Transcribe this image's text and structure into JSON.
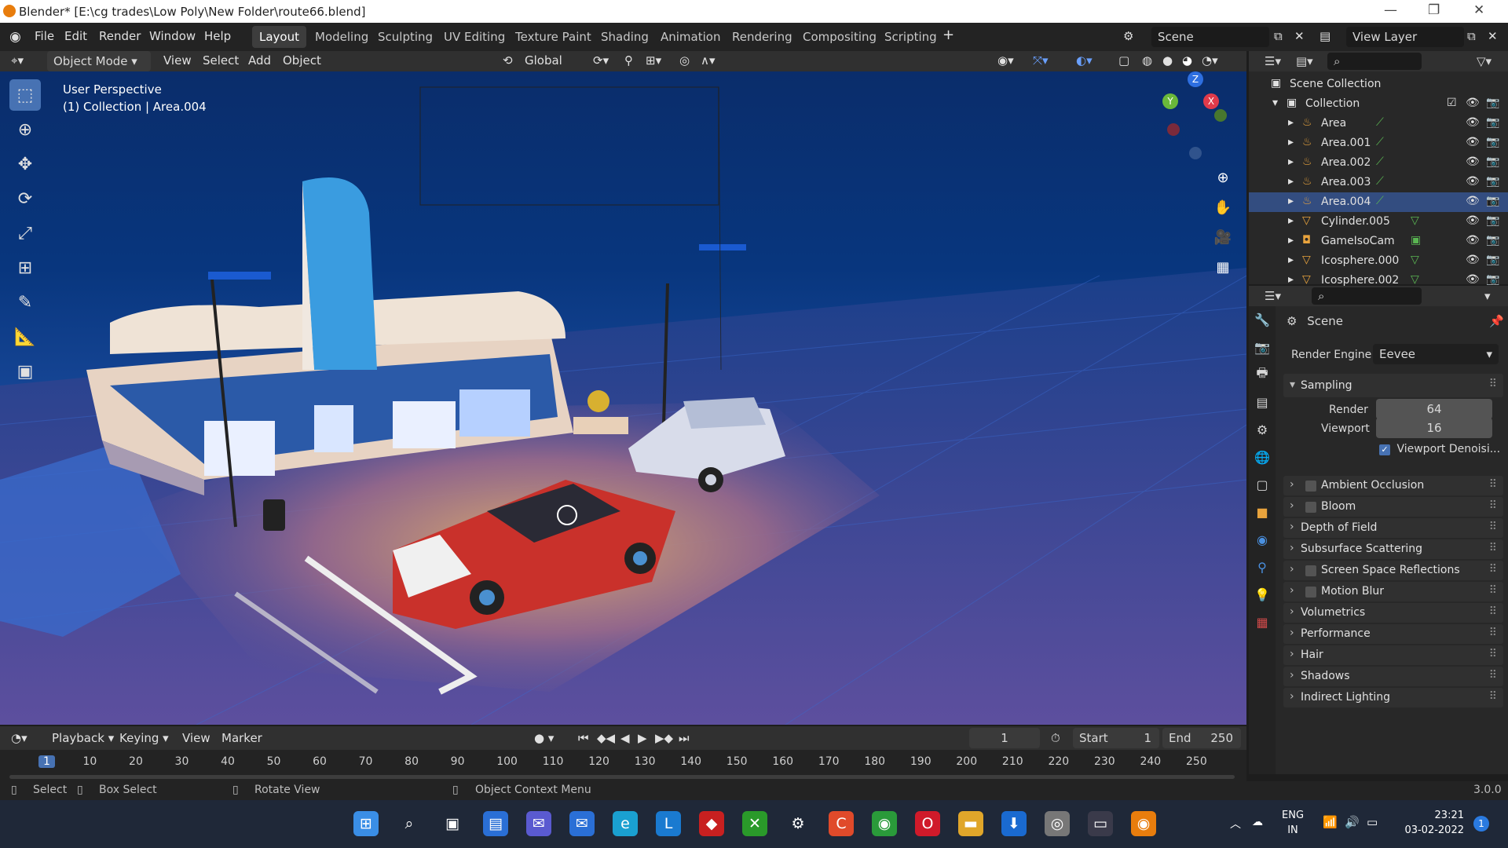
{
  "window": {
    "title": "Blender* [E:\\cg trades\\Low Poly\\New Folder\\route66.blend]"
  },
  "menu": {
    "items": [
      "File",
      "Edit",
      "Render",
      "Window",
      "Help"
    ]
  },
  "workspaces": [
    "Layout",
    "Modeling",
    "Sculpting",
    "UV Editing",
    "Texture Paint",
    "Shading",
    "Animation",
    "Rendering",
    "Compositing",
    "Scripting"
  ],
  "active_workspace": "Layout",
  "scene_field": "Scene",
  "view_layer_field": "View Layer",
  "viewport_header": {
    "mode": "Object Mode",
    "menus": [
      "View",
      "Select",
      "Add",
      "Object"
    ],
    "transform": "Global"
  },
  "viewport": {
    "perspective": "User Perspective",
    "collection_info": "(1) Collection | Area.004",
    "gizmo": {
      "z": "Z",
      "y": "Y",
      "x": "X"
    }
  },
  "tools": [
    "select-box-icon",
    "cursor-icon",
    "move-icon",
    "rotate-icon",
    "scale-icon",
    "transform-icon",
    "annotate-icon",
    "measure-icon",
    "add-cube-icon"
  ],
  "outliner": {
    "scene_collection": "Scene Collection",
    "collection": "Collection",
    "items": [
      {
        "name": "Area",
        "type": "light"
      },
      {
        "name": "Area.001",
        "type": "light"
      },
      {
        "name": "Area.002",
        "type": "light"
      },
      {
        "name": "Area.003",
        "type": "light"
      },
      {
        "name": "Area.004",
        "type": "light",
        "selected": true
      },
      {
        "name": "Cylinder.005",
        "type": "mesh"
      },
      {
        "name": "GameIsoCam",
        "type": "camera"
      },
      {
        "name": "Icosphere.000",
        "type": "mesh"
      },
      {
        "name": "Icosphere.002",
        "type": "mesh"
      }
    ]
  },
  "properties": {
    "context": "Scene",
    "render_engine_label": "Render Engine",
    "render_engine": "Eevee",
    "sampling": {
      "title": "Sampling",
      "render_label": "Render",
      "render": "64",
      "viewport_label": "Viewport",
      "viewport": "16",
      "denoise": "Viewport Denoisi..."
    },
    "sections": [
      {
        "name": "Ambient Occlusion",
        "checkbox": true
      },
      {
        "name": "Bloom",
        "checkbox": true
      },
      {
        "name": "Depth of Field",
        "checkbox": false
      },
      {
        "name": "Subsurface Scattering",
        "checkbox": false
      },
      {
        "name": "Screen Space Reflections",
        "checkbox": true
      },
      {
        "name": "Motion Blur",
        "checkbox": true
      },
      {
        "name": "Volumetrics",
        "checkbox": false
      },
      {
        "name": "Performance",
        "checkbox": false
      },
      {
        "name": "Hair",
        "checkbox": false
      },
      {
        "name": "Shadows",
        "checkbox": false
      },
      {
        "name": "Indirect Lighting",
        "checkbox": false
      }
    ]
  },
  "timeline": {
    "menus": [
      "Playback",
      "Keying",
      "View",
      "Marker"
    ],
    "current_frame": "1",
    "start_label": "Start",
    "start": "1",
    "end_label": "End",
    "end": "250",
    "ticks": [
      "1",
      "10",
      "20",
      "30",
      "40",
      "50",
      "60",
      "70",
      "80",
      "90",
      "100",
      "110",
      "120",
      "130",
      "140",
      "150",
      "160",
      "170",
      "180",
      "190",
      "200",
      "210",
      "220",
      "230",
      "240",
      "250"
    ]
  },
  "statusbar": {
    "select": "Select",
    "box_select": "Box Select",
    "rotate_view": "Rotate View",
    "context_menu": "Object Context Menu",
    "version": "3.0.0"
  },
  "taskbar": {
    "lang": "ENG",
    "region": "IN",
    "time": "23:21",
    "date": "03-02-2022",
    "notif": "1"
  },
  "colors": {
    "accent": "#4772b3",
    "selected_row": "#334d80",
    "light_icon": "#e8a33d",
    "mesh_icon": "#e8a33d",
    "object_green": "#5ab552"
  }
}
